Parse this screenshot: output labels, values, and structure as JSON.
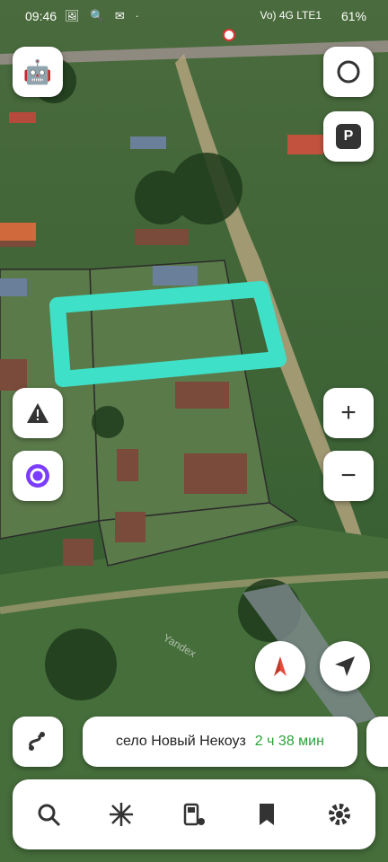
{
  "status_bar": {
    "time": "09:46",
    "left_icons": [
      "image-icon",
      "search-icon",
      "message-icon",
      "dot-icon"
    ],
    "right_text": "Vo) 4G LTE1",
    "battery": "61%"
  },
  "map": {
    "provider_watermark": "Yandex",
    "highlight_color": "#3fe0c8"
  },
  "controls": {
    "assistant_icon": "robot-icon",
    "layers_icon": "layers-icon",
    "parking_label": "P",
    "warning_icon": "warning-icon",
    "alice_icon": "alice-icon",
    "zoom_in_label": "+",
    "zoom_out_label": "−",
    "compass_icon": "compass-icon",
    "location_icon": "location-arrow-icon",
    "route_settings_icon": "route-settings-icon"
  },
  "route": {
    "destination": "село Новый Некоуз",
    "duration": "2 ч 38 мин"
  },
  "tabbar": {
    "items": [
      "search-icon",
      "discover-icon",
      "fuel-icon",
      "bookmarks-icon",
      "settings-icon"
    ]
  },
  "colors": {
    "accent_green": "#2aa23a",
    "alice_purple": "#7b3cff"
  }
}
